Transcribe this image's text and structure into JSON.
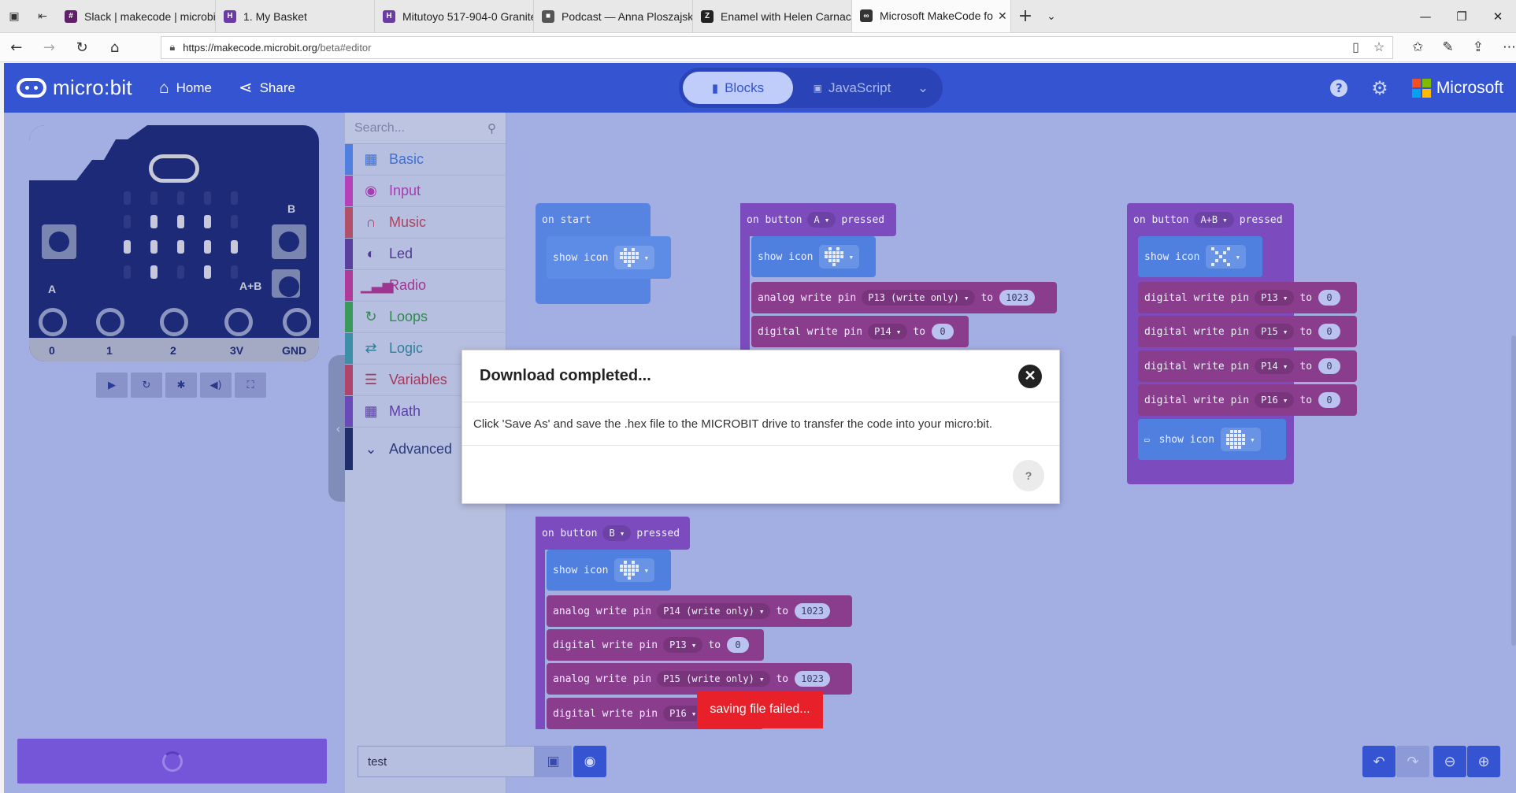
{
  "browser": {
    "tabs": [
      {
        "title": "Slack | makecode | microbit",
        "fav": "slack",
        "color": "#611f69"
      },
      {
        "title": "1. My Basket",
        "fav": "HR",
        "color": "#6a3aa5"
      },
      {
        "title": "Mitutoyo 517-904-0 Granite",
        "fav": "HR",
        "color": "#6a3aa5"
      },
      {
        "title": "Podcast — Anna Ploszajski",
        "fav": "box",
        "color": "#555555"
      },
      {
        "title": "Enamel with Helen Carnac |",
        "fav": "Z",
        "color": "#222222"
      },
      {
        "title": "Microsoft MakeCode fo",
        "fav": "link",
        "color": "#333333"
      }
    ],
    "url_host": "https://makecode.microbit.org",
    "url_path": "/beta#editor"
  },
  "header": {
    "brand": "micro:bit",
    "home_label": "Home",
    "share_label": "Share",
    "blocks_label": "Blocks",
    "javascript_label": "JavaScript",
    "microsoft_label": "Microsoft",
    "accent": "#3454d1"
  },
  "simulator": {
    "pin_labels": [
      "0",
      "1",
      "2",
      "3V",
      "GND"
    ],
    "button_a": "A",
    "button_b": "B",
    "button_ab": "A+B"
  },
  "toolbox": {
    "search_placeholder": "Search...",
    "categories": [
      {
        "label": "Basic",
        "color": "#1e90ff",
        "icon": "grid-icon"
      },
      {
        "label": "Input",
        "color": "#d400d4",
        "icon": "target-icon"
      },
      {
        "label": "Music",
        "color": "#e63022",
        "icon": "headphones-icon"
      },
      {
        "label": "Led",
        "color": "#5c2d91",
        "icon": "toggle-icon"
      },
      {
        "label": "Radio",
        "color": "#e3008c",
        "icon": "signal-icon"
      },
      {
        "label": "Loops",
        "color": "#00aa00",
        "icon": "loop-icon"
      },
      {
        "label": "Logic",
        "color": "#00a4a6",
        "icon": "shuffle-icon"
      },
      {
        "label": "Variables",
        "color": "#dc143c",
        "icon": "list-icon"
      },
      {
        "label": "Math",
        "color": "#9400d3",
        "icon": "calculator-icon"
      }
    ],
    "advanced_label": "Advanced"
  },
  "blocks": {
    "on_start": "on start",
    "show_icon": "show icon",
    "on_button": "on button",
    "pressed": "pressed",
    "analog_write": "analog write pin",
    "digital_write": "digital write pin",
    "to": "to",
    "btn_a": "A",
    "btn_b": "B",
    "btn_ab": "A+B",
    "a_rows": [
      {
        "kind": "analog write pin",
        "pin": "P13 (write only)",
        "value": "1023"
      },
      {
        "kind": "digital write pin",
        "pin": "P14",
        "value": "0"
      }
    ],
    "ab_rows": [
      {
        "pin": "P13",
        "value": "0"
      },
      {
        "pin": "P15",
        "value": "0"
      },
      {
        "pin": "P14",
        "value": "0"
      },
      {
        "pin": "P16",
        "value": "0"
      }
    ],
    "b_rows": [
      {
        "kind": "analog write pin",
        "pin": "P14 (write only)",
        "value": "1023"
      },
      {
        "kind": "digital write pin",
        "pin": "P13",
        "value": "0"
      },
      {
        "kind": "analog write pin",
        "pin": "P15 (write only)",
        "value": "1023"
      },
      {
        "kind": "digital write pin",
        "pin": "P16",
        "value": ""
      }
    ]
  },
  "modal": {
    "title": "Download completed...",
    "message": "Click 'Save As' and save the .hex file to the MICROBIT drive to transfer the code into your micro:bit.",
    "help": "?"
  },
  "toast": {
    "message": "saving file failed...",
    "color": "#e8202a"
  },
  "bottom": {
    "project_name": "test"
  }
}
